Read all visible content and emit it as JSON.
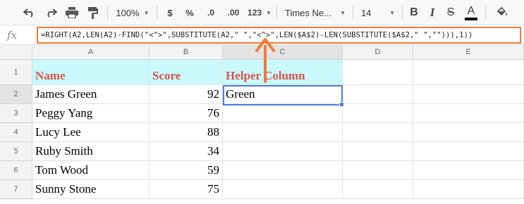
{
  "toolbar": {
    "zoom": "100%",
    "currency": "$",
    "percent": "%",
    "decrease_decimals": ".0",
    "increase_decimals": ".00",
    "more_formats": "123",
    "font_name": "Times Ne...",
    "font_size": "14",
    "bold": "B",
    "italic": "I",
    "strikethrough": "S",
    "text_color": "A",
    "text_color_swatch": "#000000",
    "icons": [
      "undo-icon",
      "redo-icon",
      "print-icon",
      "paint-format-icon",
      "fill-color-icon"
    ]
  },
  "formula_bar": {
    "fx_label": "fx",
    "formula": "=RIGHT(A2,LEN(A2)-FIND(\"<^>\",SUBSTITUTE(A2,\" \",\"<^>\",LEN($A$2)-LEN(SUBSTITUTE($A$2,\" \",\"\"))),1))",
    "highlight_color": "#f07a35"
  },
  "grid": {
    "columns": [
      "A",
      "B",
      "C",
      "D",
      "E"
    ],
    "rows": [
      "1",
      "2",
      "3",
      "4",
      "5",
      "6",
      "7"
    ],
    "headers": [
      "Name",
      "Score",
      "Helper Column"
    ],
    "data": [
      {
        "name": "James Green",
        "score": "92",
        "helper": "Green"
      },
      {
        "name": "Peggy Yang",
        "score": "76",
        "helper": ""
      },
      {
        "name": "Lucy Lee",
        "score": "88",
        "helper": ""
      },
      {
        "name": "Ruby Smith",
        "score": "34",
        "helper": ""
      },
      {
        "name": "Tom Wood",
        "score": "59",
        "helper": ""
      },
      {
        "name": "Sunny Stone",
        "score": "75",
        "helper": ""
      }
    ],
    "header_fill": "#c9f9fa",
    "header_text_color": "#d9534f",
    "selection_color": "#4a7de5",
    "selected_cell": "C2"
  }
}
